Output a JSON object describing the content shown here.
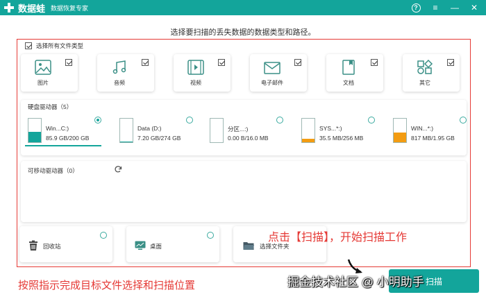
{
  "titlebar": {
    "app_name": "数据蛙",
    "subtitle": "数据恢复专家",
    "help_icon": "help-icon",
    "menu_icon": "hamburger-menu-icon",
    "minimize_icon": "minimize-icon",
    "close_icon": "close-icon",
    "color": "#13a59b"
  },
  "instruction": "选择要扫描的丢失数据的数据类型和路径。",
  "file_types": {
    "select_all_label": "选择所有文件类型",
    "select_all_checked": true,
    "items": [
      {
        "label": "图片",
        "icon": "image-icon",
        "checked": true
      },
      {
        "label": "音频",
        "icon": "music-icon",
        "checked": true
      },
      {
        "label": "视频",
        "icon": "video-icon",
        "checked": true
      },
      {
        "label": "电子邮件",
        "icon": "email-icon",
        "checked": true
      },
      {
        "label": "文档",
        "icon": "document-icon",
        "checked": true
      },
      {
        "label": "其它",
        "icon": "other-shapes-icon",
        "checked": true
      }
    ]
  },
  "hard_drives": {
    "section_label": "硬盘驱动器（5）",
    "items": [
      {
        "name": "Win...C:)",
        "size": "85.9 GB/200 GB",
        "fill_fraction": 0.43,
        "fill_color": "#13a59b",
        "selected": true
      },
      {
        "name": "Data (D:)",
        "size": "7.20 GB/274 GB",
        "fill_fraction": 0.03,
        "fill_color": "#13a59b",
        "selected": false
      },
      {
        "name": "分区...:)",
        "size": "0.00  B/16.0 MB",
        "fill_fraction": 0.0,
        "fill_color": "#f39c12",
        "selected": false
      },
      {
        "name": "SYS...*:)",
        "size": "35.5 MB/256 MB",
        "fill_fraction": 0.14,
        "fill_color": "#f39c12",
        "selected": false
      },
      {
        "name": "WIN...*:)",
        "size": "817 MB/1.95 GB",
        "fill_fraction": 0.42,
        "fill_color": "#f39c12",
        "selected": false
      }
    ]
  },
  "removable_drives": {
    "section_label": "可移动驱动器（0）",
    "refresh_icon": "refresh-icon"
  },
  "locations": [
    {
      "label": "回收站",
      "icon": "recycle-bin-icon"
    },
    {
      "label": "桌面",
      "icon": "desktop-icon"
    },
    {
      "label": "选择文件夹",
      "icon": "folder-icon"
    }
  ],
  "annotations": {
    "scan_hint": "点击【扫描】，开始扫描工作",
    "bottom_hint": "按照指示完成目标文件选择和扫描位置",
    "color": "#e53935"
  },
  "watermark": "掘金技术社区 @ 小明助手",
  "scan_button": {
    "label": "扫描"
  }
}
